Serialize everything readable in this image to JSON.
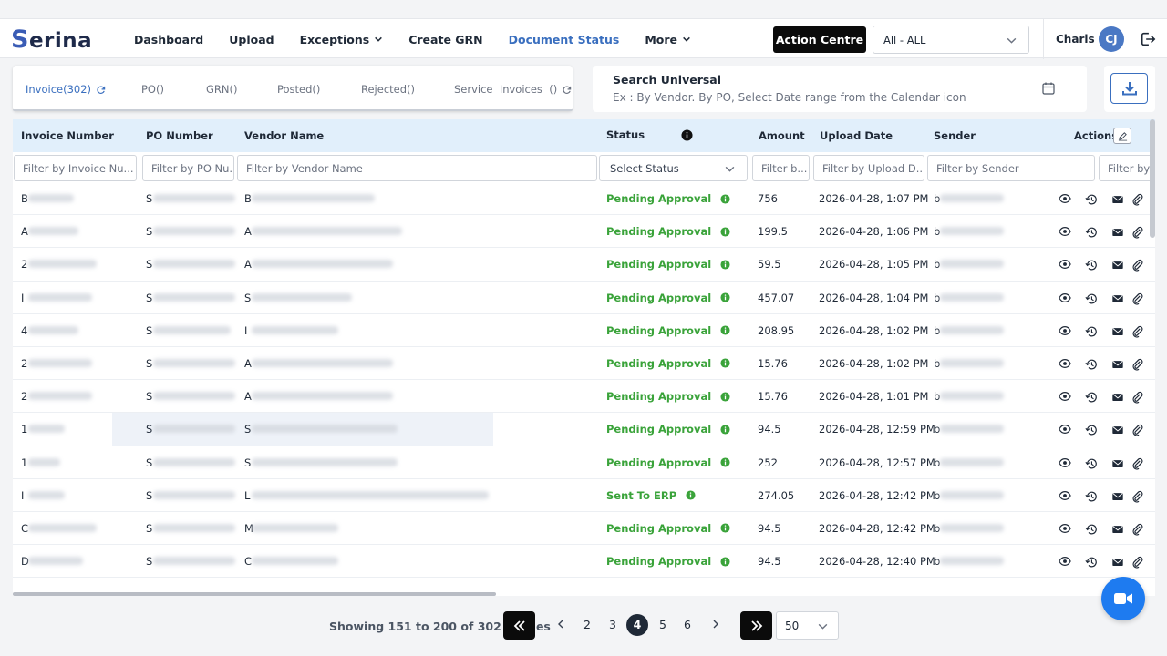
{
  "app": {
    "logo_text": "Serina",
    "logo_first_letter": "S",
    "logo_rest": "erina"
  },
  "nav": {
    "items": [
      {
        "label": "Dashboard",
        "active": false,
        "dropdown": false
      },
      {
        "label": "Upload",
        "active": false,
        "dropdown": false
      },
      {
        "label": "Exceptions",
        "active": false,
        "dropdown": true
      },
      {
        "label": "Create GRN",
        "active": false,
        "dropdown": false
      },
      {
        "label": "Document Status",
        "active": true,
        "dropdown": false
      },
      {
        "label": "More",
        "active": false,
        "dropdown": true
      }
    ],
    "action_centre_label": "Action Centre",
    "entity_select_value": "All - ALL"
  },
  "user": {
    "name": "Charls",
    "initials": "CJ"
  },
  "tabs": [
    {
      "label": "Invoice(302)",
      "active": true,
      "refresh": true
    },
    {
      "label": "PO()",
      "active": false,
      "refresh": false
    },
    {
      "label": "GRN()",
      "active": false,
      "refresh": false
    },
    {
      "label": "Posted()",
      "active": false,
      "refresh": false
    },
    {
      "label": "Rejected()",
      "active": false,
      "refresh": false
    },
    {
      "label": "Service  Invoices  ()",
      "active": false,
      "refresh": true
    }
  ],
  "search": {
    "title": "Search Universal",
    "placeholder": "Ex : By Vendor. By PO, Select Date range from the Calendar icon"
  },
  "table": {
    "headers": {
      "invoice_number": "Invoice Number",
      "po_number": "PO Number",
      "vendor_name": "Vendor Name",
      "status": "Status",
      "amount": "Amount",
      "upload_date": "Upload Date",
      "sender": "Sender",
      "actions": "Actions"
    },
    "filters": {
      "invoice_number": "Filter by Invoice Nu...",
      "po_number": "Filter by PO Nu...",
      "vendor_name": "Filter by Vendor Name",
      "status": "Select Status",
      "amount": "Filter b...",
      "upload_date": "Filter by Upload D...",
      "sender": "Filter by Sender",
      "extra": "Filter by G"
    },
    "rows": [
      {
        "invoice_first": "B",
        "po_first": "S",
        "vendor_first": "B",
        "sender_first": "b",
        "status": "Pending Approval",
        "amount": "756",
        "upload_date": "2026-04-28, 1:07 PM"
      },
      {
        "invoice_first": "A",
        "po_first": "S",
        "vendor_first": "A",
        "sender_first": "b",
        "status": "Pending Approval",
        "amount": "199.5",
        "upload_date": "2026-04-28, 1:06 PM"
      },
      {
        "invoice_first": "2",
        "po_first": "S",
        "vendor_first": "A",
        "sender_first": "b",
        "status": "Pending Approval",
        "amount": "59.5",
        "upload_date": "2026-04-28, 1:05 PM"
      },
      {
        "invoice_first": "I",
        "po_first": "S",
        "vendor_first": "S",
        "sender_first": "b",
        "status": "Pending Approval",
        "amount": "457.07",
        "upload_date": "2026-04-28, 1:04 PM"
      },
      {
        "invoice_first": "4",
        "po_first": "S",
        "vendor_first": "I",
        "sender_first": "b",
        "status": "Pending Approval",
        "amount": "208.95",
        "upload_date": "2026-04-28, 1:02 PM"
      },
      {
        "invoice_first": "2",
        "po_first": "S",
        "vendor_first": "A",
        "sender_first": "b",
        "status": "Pending Approval",
        "amount": "15.76",
        "upload_date": "2026-04-28, 1:02 PM"
      },
      {
        "invoice_first": "2",
        "po_first": "S",
        "vendor_first": "A",
        "sender_first": "b",
        "status": "Pending Approval",
        "amount": "15.76",
        "upload_date": "2026-04-28, 1:01 PM"
      },
      {
        "invoice_first": "1",
        "po_first": "S",
        "vendor_first": "S",
        "sender_first": "b",
        "status": "Pending Approval",
        "amount": "94.5",
        "upload_date": "2026-04-28, 12:59 PM",
        "highlight": true
      },
      {
        "invoice_first": "1",
        "po_first": "S",
        "vendor_first": "S",
        "sender_first": "b",
        "status": "Pending Approval",
        "amount": "252",
        "upload_date": "2026-04-28, 12:57 PM"
      },
      {
        "invoice_first": "I",
        "po_first": "S",
        "vendor_first": "L",
        "sender_first": "b",
        "status": "Sent To ERP",
        "amount": "274.05",
        "upload_date": "2026-04-28, 12:42 PM"
      },
      {
        "invoice_first": "C",
        "po_first": "S",
        "vendor_first": "M",
        "sender_first": "b",
        "status": "Pending Approval",
        "amount": "94.5",
        "upload_date": "2026-04-28, 12:42 PM"
      },
      {
        "invoice_first": "D",
        "po_first": "S",
        "vendor_first": "C",
        "sender_first": "b",
        "status": "Pending Approval",
        "amount": "94.5",
        "upload_date": "2026-04-28, 12:40 PM"
      }
    ]
  },
  "pagination": {
    "showing_text": "Showing 151 to 200 of 302 entries",
    "pages": [
      "2",
      "3",
      "4",
      "5",
      "6"
    ],
    "current_page": "4",
    "per_page": "50"
  },
  "colors": {
    "accent": "#3a6fbf",
    "status_green": "#3aa33a",
    "header_bg": "#e1effb",
    "video_button": "#1e7bf0"
  },
  "icons": [
    "refresh-icon",
    "calendar-icon",
    "download-icon",
    "info-icon",
    "edit-icon",
    "eye-icon",
    "history-icon",
    "mail-icon",
    "attachment-icon",
    "logout-icon",
    "video-icon",
    "chevron-down-icon",
    "double-chevron-left-icon",
    "double-chevron-right-icon",
    "chevron-left-icon",
    "chevron-right-icon"
  ]
}
